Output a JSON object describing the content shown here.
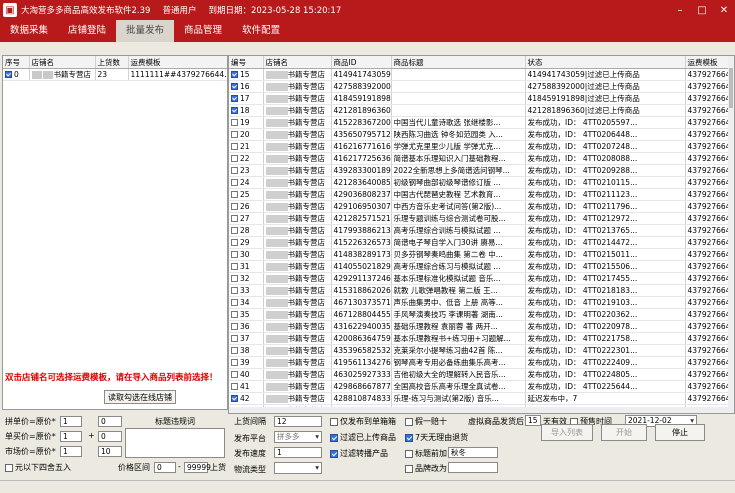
{
  "app": {
    "title": "大淘营多多商品高效发布软件2.39",
    "user_type": "普通用户",
    "expire": "到期日期：2023-05-28 15:20:17",
    "min": "–",
    "max": "□",
    "close": "✕"
  },
  "menu": [
    "数据采集",
    "店铺登陆",
    "批量发布",
    "商品管理",
    "软件配置"
  ],
  "left_table": {
    "headers": [
      "序号",
      "店铺名",
      "上货数",
      "运费模板"
    ],
    "rows": [
      {
        "checked": true,
        "no": "0",
        "shop": "书籍专营店",
        "count": "23",
        "template": "1111111##4379276644..."
      }
    ]
  },
  "hint": "双击店铺名可选择运费模板，请在导入商品列表前选择！",
  "read_btn": "读取勾选在线店铺",
  "right_table": {
    "headers": [
      "编号",
      "店铺名",
      "商品ID",
      "商品标题",
      "状态",
      "运费模板"
    ],
    "rows": [
      {
        "checked": true,
        "no": "15",
        "shop": "书籍专营店",
        "id": "414941743059",
        "title": "",
        "status": "414941743059|过滤已上传商品",
        "tpl": "43792766441971"
      },
      {
        "checked": true,
        "no": "16",
        "shop": "书籍专营店",
        "id": "427588392000",
        "title": "",
        "status": "427588392000|过滤已上传商品",
        "tpl": "43792766441971"
      },
      {
        "checked": true,
        "no": "17",
        "shop": "书籍专营店",
        "id": "418459191898",
        "title": "",
        "status": "418459191898|过滤已上传商品",
        "tpl": "43792766441971"
      },
      {
        "checked": true,
        "no": "18",
        "shop": "书籍专营店",
        "id": "421281896360",
        "title": "",
        "status": "421281896360|过滤已上传商品",
        "tpl": "43792766441971"
      },
      {
        "checked": false,
        "no": "19",
        "shop": "书籍专营店",
        "id": "415228367200",
        "title": "中国当代儿童诗歌选 张继楼影...",
        "status": "发布成功，ID： 4TT0205597...",
        "tpl": "43792766441971"
      },
      {
        "checked": false,
        "no": "20",
        "shop": "书籍专营店",
        "id": "435650795712",
        "title": "陕西陈习曲选 钟冬如范园类 入...",
        "status": "发布成功，ID： 4TT0206448...",
        "tpl": "43792766441971"
      },
      {
        "checked": false,
        "no": "21",
        "shop": "书籍专营店",
        "id": "416216771616",
        "title": "学弹尤克里里少儿版  学弹尤克...",
        "status": "发布成功，ID： 4TT0207248...",
        "tpl": "43792766441971"
      },
      {
        "checked": false,
        "no": "22",
        "shop": "书籍专营店",
        "id": "416217725636",
        "title": "简谱基本乐理知识入门基础教程...",
        "status": "发布成功，ID： 4TT0208088...",
        "tpl": "43792766441971"
      },
      {
        "checked": false,
        "no": "23",
        "shop": "书籍专营店",
        "id": "439283300189",
        "title": "2022全新思想上多简谱选问钢琴...",
        "status": "发布成功，ID： 4TT0209288...",
        "tpl": "43792766441971"
      },
      {
        "checked": false,
        "no": "24",
        "shop": "书籍专营店",
        "id": "421283640085",
        "title": "初级钢琴曲部初级琴谱修订版 ...",
        "status": "发布成功，ID： 4TT0210115...",
        "tpl": "43792766441971"
      },
      {
        "checked": false,
        "no": "25",
        "shop": "书籍专营店",
        "id": "429036808237",
        "title": "中国古代琵琶史教程 艺术教育...",
        "status": "发布成功，ID： 4TT0211123...",
        "tpl": "43792766441971"
      },
      {
        "checked": false,
        "no": "26",
        "shop": "书籍专营店",
        "id": "429106950307",
        "title": "中西方音乐史考试问答(第2版)...",
        "status": "发布成功，ID： 4TT0211796...",
        "tpl": "43792766441971"
      },
      {
        "checked": false,
        "no": "27",
        "shop": "书籍专营店",
        "id": "421282571521",
        "title": "乐理专题训练与综合测试卷可股...",
        "status": "发布成功，ID： 4TT0212972...",
        "tpl": "43792766441971"
      },
      {
        "checked": false,
        "no": "28",
        "shop": "书籍专营店",
        "id": "417993886213",
        "title": "高考乐理综合训练与模拟试题 ...",
        "status": "发布成功，ID： 4TT0213765...",
        "tpl": "43792766441971"
      },
      {
        "checked": false,
        "no": "29",
        "shop": "书籍专营店",
        "id": "415226326573",
        "title": "简谱电子琴自学入门30讲  赓易...",
        "status": "发布成功，ID： 4TT0214472...",
        "tpl": "43792766441971"
      },
      {
        "checked": false,
        "no": "30",
        "shop": "书籍专营店",
        "id": "414838289173",
        "title": "贝多芬钢琴奏鸣曲集 第二卷 中...",
        "status": "发布成功，ID： 4TT0215011...",
        "tpl": "43792766441971"
      },
      {
        "checked": false,
        "no": "31",
        "shop": "书籍专营店",
        "id": "414055021829",
        "title": "高考乐理综合练习与模拟试题 ...",
        "status": "发布成功，ID： 4TT0215506...",
        "tpl": "43792766441971"
      },
      {
        "checked": false,
        "no": "32",
        "shop": "书籍专营店",
        "id": "429291137246",
        "title": "基本乐理标准化模拟试题 音乐...",
        "status": "发布成功，ID： 4TT0217455...",
        "tpl": "43792766441971"
      },
      {
        "checked": false,
        "no": "33",
        "shop": "书籍专营店",
        "id": "415318862026",
        "title": "就教 儿歌弹唱教程 第二版 王...",
        "status": "发布成功，ID： 4TT0218183...",
        "tpl": "43792766441971"
      },
      {
        "checked": false,
        "no": "34",
        "shop": "书籍专营店",
        "id": "467130373571",
        "title": "声乐曲集男中、低音 上册 高等...",
        "status": "发布成功，ID： 4TT0219103...",
        "tpl": "43792766441971"
      },
      {
        "checked": false,
        "no": "35",
        "shop": "书籍专营店",
        "id": "467128804455",
        "title": "手风琴演奏技巧 李课明著 湖南...",
        "status": "发布成功，ID： 4TT0220362...",
        "tpl": "43792766441971"
      },
      {
        "checked": false,
        "no": "36",
        "shop": "书籍专营店",
        "id": "431622940035",
        "title": "基础乐理教程 袁丽蓉 著 两开...",
        "status": "发布成功，ID： 4TT0220978...",
        "tpl": "43792766441971"
      },
      {
        "checked": false,
        "no": "37",
        "shop": "书籍专营店",
        "id": "420086364759",
        "title": "基本乐理教程书+练习册+习题解...",
        "status": "发布成功，ID： 4TT0221758...",
        "tpl": "43792766441971"
      },
      {
        "checked": false,
        "no": "38",
        "shop": "书籍专营店",
        "id": "435396582532",
        "title": "克莱采尔小提琴练习曲42首 陈...",
        "status": "发布成功，ID： 4TT0222301...",
        "tpl": "43792766441971"
      },
      {
        "checked": false,
        "no": "39",
        "shop": "书籍专营店",
        "id": "419561134276",
        "title": "钢琴高考专用必备练曲集乐高考...",
        "status": "发布成功，ID： 4TT0222409...",
        "tpl": "43792766441971"
      },
      {
        "checked": false,
        "no": "40",
        "shop": "书籍专营店",
        "id": "463025927333",
        "title": "吉他初级大全的理解转入民音乐...",
        "status": "发布成功，ID： 4TT0224805...",
        "tpl": "43792766441971"
      },
      {
        "checked": false,
        "no": "41",
        "shop": "书籍专营店",
        "id": "429868667877",
        "title": "全国高校音乐高考乐理全真试卷...",
        "status": "发布成功，ID： 4TT0225644...",
        "tpl": "43792766441971"
      },
      {
        "checked": true,
        "no": "42",
        "shop": "书籍专营店",
        "id": "428810874833",
        "title": "乐理-练习与测试(第2版) 音乐...",
        "status": "延迟发布中，7",
        "tpl": "43792766441971"
      },
      {
        "checked": true,
        "no": "43",
        "shop": "书籍专营店",
        "id": "415313766449",
        "title": "",
        "status": "",
        "tpl": "43792766441971"
      },
      {
        "checked": true,
        "no": "44",
        "shop": "书籍专营店",
        "id": "416219625366",
        "title": "",
        "status": "",
        "tpl": "43792766441971"
      },
      {
        "checked": true,
        "no": "45",
        "shop": "书籍专营店",
        "id": "470547093702",
        "title": "",
        "status": "",
        "tpl": "43792766441971"
      },
      {
        "checked": true,
        "no": "46",
        "shop": "书籍专营店",
        "id": "435396877974",
        "title": "",
        "status": "",
        "tpl": "43792766441971"
      }
    ]
  },
  "form": {
    "pindan_label": "拼单价=原价*",
    "pindan_a": "1",
    "pindan_b": "0",
    "danmai_label": "单买价=原价*",
    "danmai_a": "1",
    "plus": "+",
    "danmai_b": "0",
    "market_label": "市场价=原价*",
    "market_a": "1",
    "market_b": "10",
    "round_label": "元以下四舍五入",
    "title_filter": "标题违规词",
    "price_range": "价格区间",
    "price_min": "0",
    "dash": "-",
    "price_max": "99999",
    "price_suffix": "上货",
    "interval_label": "上货间隔",
    "interval": "12",
    "platform_label": "发布平台",
    "platform": "拼多多",
    "speed_label": "发布速度",
    "speed": "1",
    "logistics_label": "物流类型",
    "logistics": "",
    "only_rank": "仅发布到单箱箱",
    "one_to_ten": "假一赔十",
    "virtual_label": "虚拟商品发货后",
    "virtual_days": "15",
    "virtual_suffix": "天有效",
    "presale_label": "预售时间",
    "presale_date": "2021-12-02",
    "filter_uploaded": "过滤已上传商品",
    "seven_day": "7天无理由退货",
    "filter_rm": "过滤转播产品",
    "title_add": "标题前加",
    "title_add_val": "秋冬",
    "brand_to": "品牌改为",
    "import_btn": "导入列表",
    "start_btn": "开始",
    "stop_btn": "停止"
  },
  "colors": {
    "titlebar": "#b8191a",
    "accent": "#3a6fd8",
    "hint": "#dd0000"
  }
}
